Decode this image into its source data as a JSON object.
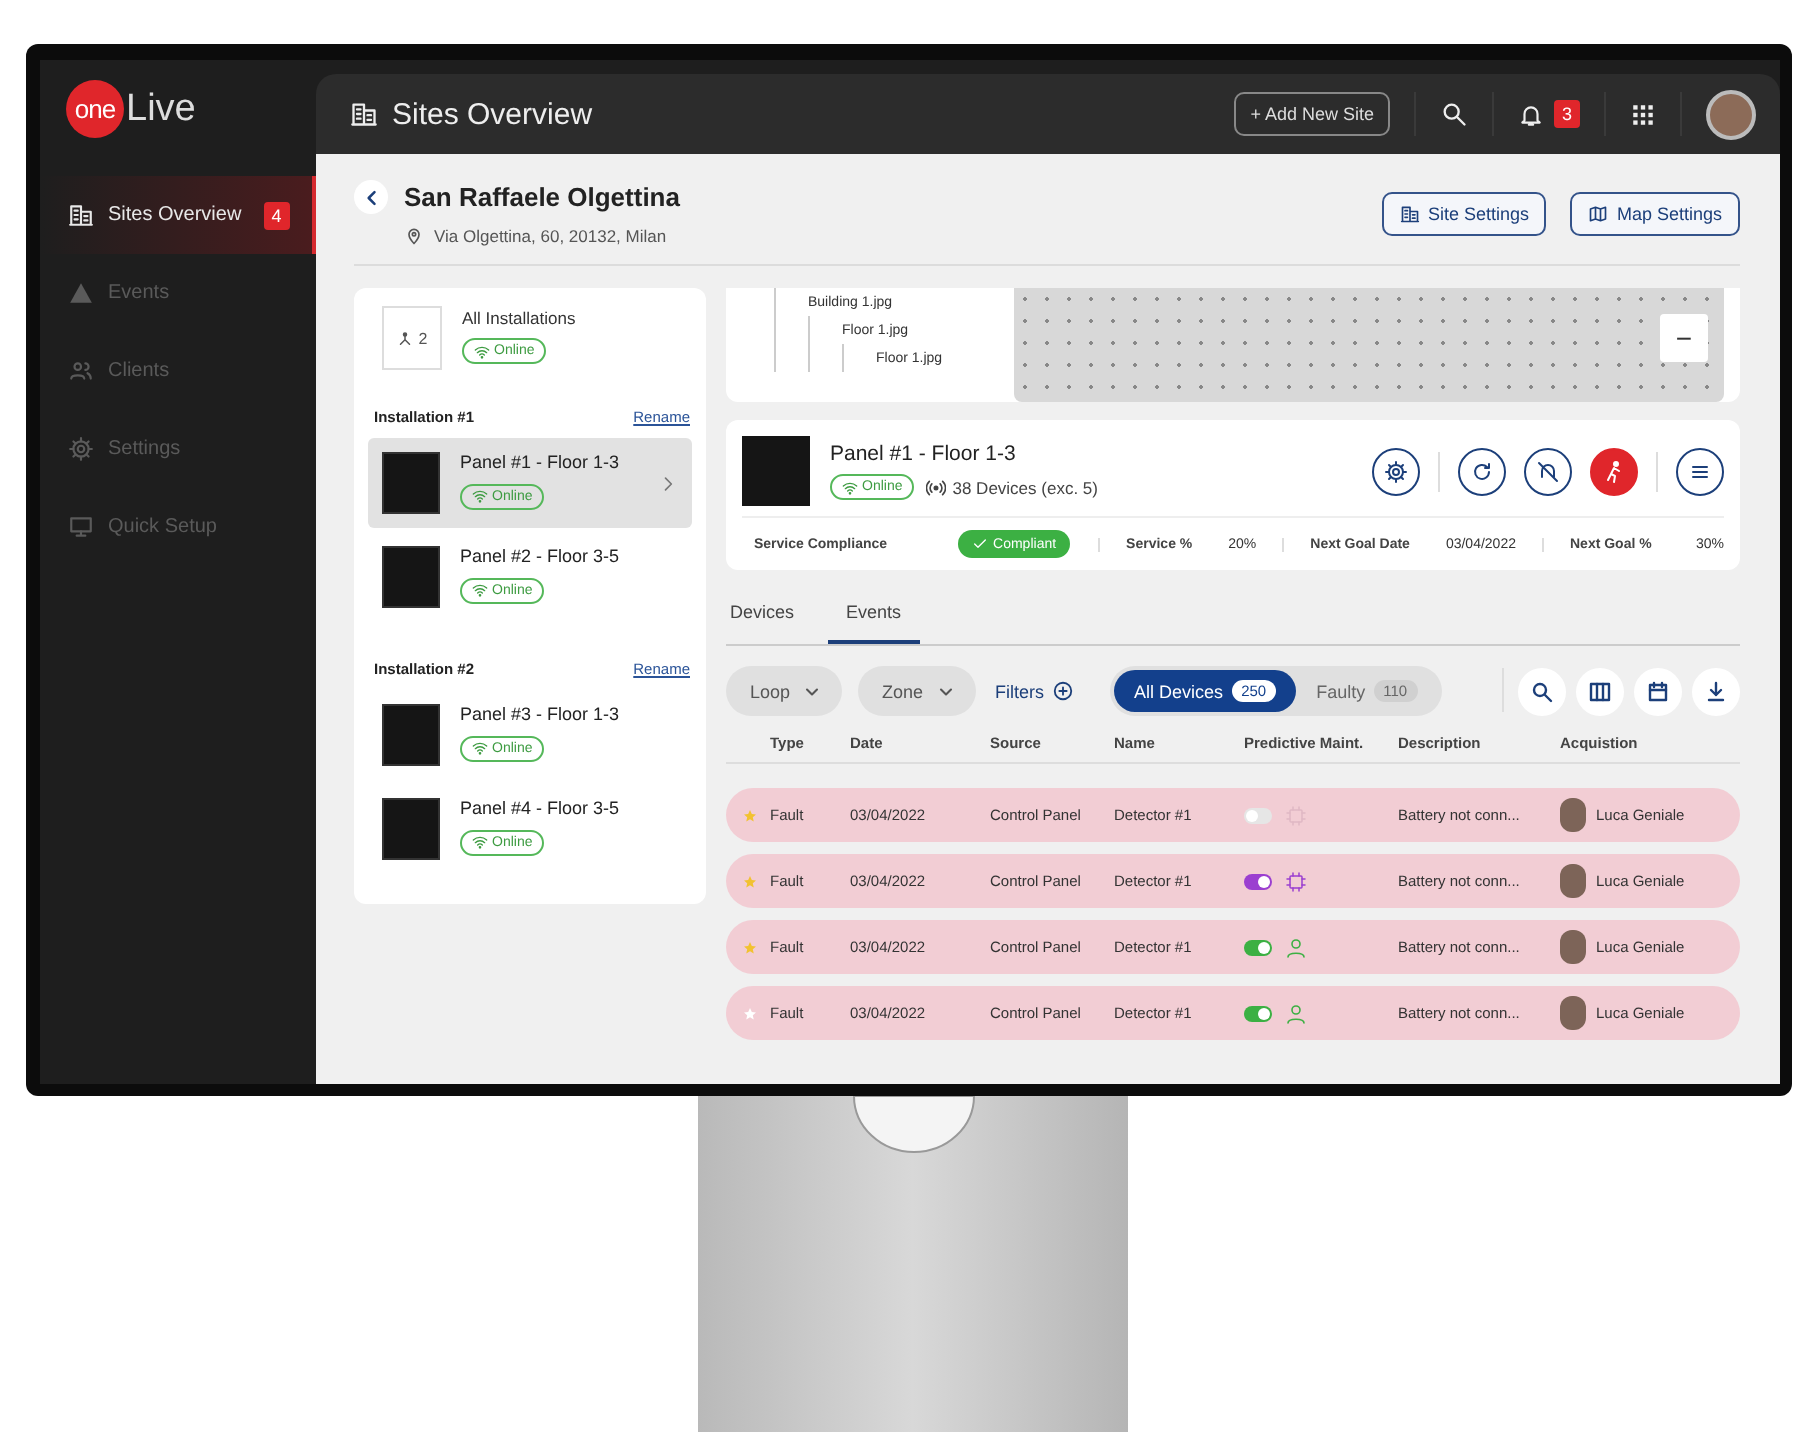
{
  "brand": {
    "mark": "one",
    "name": "Live"
  },
  "sidebar": {
    "items": [
      {
        "label": "Sites Overview",
        "kind": "building",
        "selected": true,
        "badge": "4"
      },
      {
        "label": "Events",
        "kind": "warning",
        "selected": false
      },
      {
        "label": "Clients",
        "kind": "people",
        "selected": false
      },
      {
        "label": "Settings",
        "kind": "gear",
        "selected": false
      },
      {
        "label": "Quick Setup",
        "kind": "monitor",
        "selected": false
      }
    ]
  },
  "top_bar": {
    "title": "Sites Overview",
    "add_button": "+ Add New Site",
    "notification_count": "3"
  },
  "site": {
    "name": "San Raffaele Olgettina",
    "address": "Via Olgettina, 60, 20132, Milan",
    "buttons": [
      {
        "label": "Site Settings",
        "kind": "building"
      },
      {
        "label": "Map Settings",
        "kind": "map"
      }
    ]
  },
  "installations": {
    "all": {
      "count": "2",
      "label": "All Installations",
      "status": "Online"
    },
    "groups": [
      {
        "title": "Installation #1",
        "action": "Rename",
        "panels": [
          {
            "name": "Panel #1 - Floor 1-3",
            "status": "Online",
            "selected": true
          },
          {
            "name": "Panel #2 - Floor 3-5",
            "status": "Online",
            "selected": false
          }
        ]
      },
      {
        "title": "Installation #2",
        "action": "Rename",
        "panels": [
          {
            "name": "Panel #3 - Floor 1-3",
            "status": "Online",
            "selected": false
          },
          {
            "name": "Panel #4 - Floor 3-5",
            "status": "Online",
            "selected": false
          }
        ]
      }
    ]
  },
  "map": {
    "tree": [
      {
        "label": "Building 1.jpg",
        "children": [
          {
            "label": "Floor 1.jpg",
            "children": [
              {
                "label": "Floor 1.jpg"
              }
            ]
          }
        ]
      }
    ],
    "zoom_out": "−"
  },
  "panel_detail": {
    "name": "Panel #1 - Floor 1-3",
    "status": "Online",
    "devices": "38 Devices (exc. 5)",
    "actions": [
      {
        "kind": "settings"
      },
      {
        "kind": "refresh"
      },
      {
        "kind": "mute"
      },
      {
        "kind": "alarm"
      },
      {
        "kind": "menu"
      }
    ],
    "compliance": {
      "label": "Service Compliance",
      "value": "Compliant"
    },
    "stats": [
      {
        "label": "Service %",
        "value": "20%"
      },
      {
        "label": "Next Goal Date",
        "value": "03/04/2022"
      },
      {
        "label": "Next Goal %",
        "value": "30%"
      }
    ]
  },
  "tabs": [
    {
      "label": "Devices",
      "selected": false
    },
    {
      "label": "Events",
      "selected": true
    }
  ],
  "filters": {
    "dropdowns": [
      "Loop",
      "Zone"
    ],
    "link": "Filters",
    "segments": [
      {
        "label": "All Devices",
        "count": "250",
        "selected": true
      },
      {
        "label": "Faulty",
        "count": "110",
        "selected": false
      }
    ],
    "tools": [
      {
        "kind": "search"
      },
      {
        "kind": "columns"
      },
      {
        "kind": "calendar"
      },
      {
        "kind": "download"
      }
    ]
  },
  "table": {
    "columns": [
      "Type",
      "Date",
      "Source",
      "Name",
      "Predictive Maint.",
      "Description",
      "Acquistion"
    ],
    "rows": [
      {
        "starred": true,
        "type": "Fault",
        "date": "03/04/2022",
        "source": "Control Panel",
        "name": "Detector #1",
        "predictive": {
          "on": false,
          "kind": "ai"
        },
        "description": "Battery not conn...",
        "acquisition": "Luca Geniale"
      },
      {
        "starred": true,
        "type": "Fault",
        "date": "03/04/2022",
        "source": "Control Panel",
        "name": "Detector #1",
        "predictive": {
          "on": true,
          "kind": "ai"
        },
        "description": "Battery not conn...",
        "acquisition": "Luca Geniale"
      },
      {
        "starred": true,
        "type": "Fault",
        "date": "03/04/2022",
        "source": "Control Panel",
        "name": "Detector #1",
        "predictive": {
          "on": true,
          "kind": "person"
        },
        "description": "Battery not conn...",
        "acquisition": "Luca Geniale"
      },
      {
        "starred": false,
        "type": "Fault",
        "date": "03/04/2022",
        "source": "Control Panel",
        "name": "Detector #1",
        "predictive": {
          "on": true,
          "kind": "person"
        },
        "description": "Battery not conn...",
        "acquisition": "Luca Geniale"
      }
    ]
  }
}
